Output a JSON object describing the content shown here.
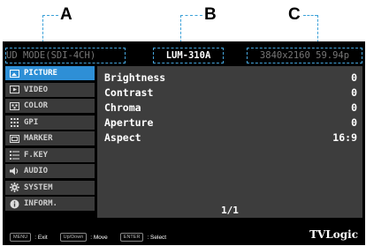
{
  "callouts": {
    "a": "A",
    "b": "B",
    "c": "C"
  },
  "topbar": {
    "mode": "UD MODE(SDI-4CH)",
    "model": "LUM-310A",
    "resolution": "3840x2160 59.94p"
  },
  "sidebar": {
    "items": [
      {
        "label": "PICTURE",
        "icon": "picture-icon"
      },
      {
        "label": "VIDEO",
        "icon": "video-icon"
      },
      {
        "label": "COLOR",
        "icon": "color-icon"
      },
      {
        "label": "GPI",
        "icon": "gpi-icon"
      },
      {
        "label": "MARKER",
        "icon": "marker-icon"
      },
      {
        "label": "F.KEY",
        "icon": "fkey-icon"
      },
      {
        "label": "AUDIO",
        "icon": "audio-icon"
      },
      {
        "label": "SYSTEM",
        "icon": "system-icon"
      },
      {
        "label": "INFORM.",
        "icon": "info-icon"
      }
    ]
  },
  "panel": {
    "rows": [
      {
        "label": "Brightness",
        "value": "0"
      },
      {
        "label": "Contrast",
        "value": "0"
      },
      {
        "label": "Chroma",
        "value": "0"
      },
      {
        "label": "Aperture",
        "value": "0"
      },
      {
        "label": "Aspect",
        "value": "16:9"
      }
    ],
    "page": "1/1"
  },
  "bottombar": {
    "menu_key": "MENU",
    "menu_desc": ": Exit",
    "move_key": "Up/Down",
    "move_desc": ": Move",
    "enter_key": "ENTER",
    "enter_desc": ": Select"
  },
  "brand": "TVLogic",
  "colors": {
    "screen_bg": "#000000",
    "panel_bg": "#3d3d3d",
    "active_item": "#2e8fd6",
    "callout_line": "#3aa0d8"
  }
}
